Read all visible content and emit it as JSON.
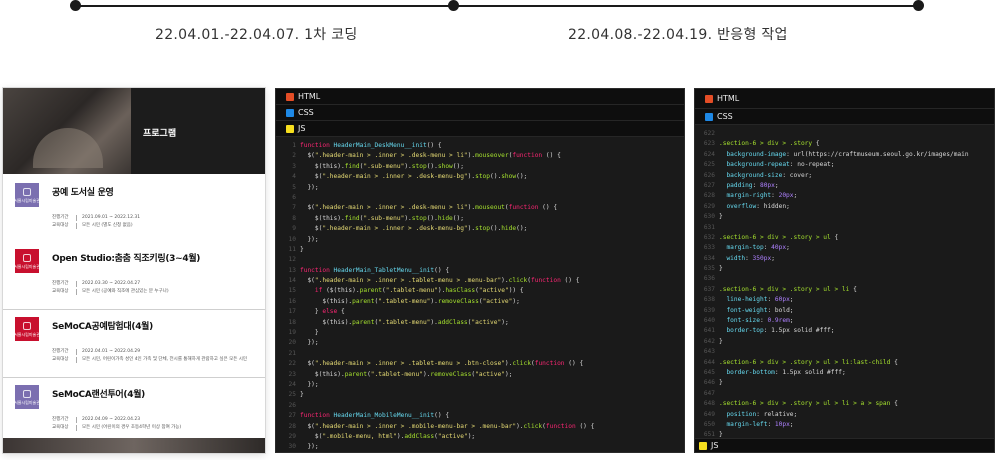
{
  "timeline": {
    "labels": [
      "22.04.01.-22.04.07. 1차 코딩",
      "22.04.08.-22.04.19. 반응형 작업"
    ]
  },
  "phone": {
    "hero_title": "프로그램",
    "logo_text": "서울시립미술관",
    "programs": [
      {
        "title": "공예 도서실 운영",
        "period_label": "진행기간",
        "period": "2021.09.01 ~ 2022.12.31",
        "target_label": "교육대상",
        "target": "모든 시민 (별도 신청 없음)",
        "logo_color": "#7b6fb0"
      },
      {
        "title": "Open Studio:춤춤 직조키링(3~4월)",
        "period_label": "진행기간",
        "period": "2022.03.30 ~ 2022.04.27",
        "target_label": "교육대상",
        "target": "모든 시민 (공예와 직조에 관심있는 분 누구나)",
        "logo_color": "#c8102e"
      },
      {
        "title": "SeMoCA공예탐험대(4월)",
        "period_label": "진행기간",
        "period": "2022.04.01 ~ 2022.04.29",
        "target_label": "교육대상",
        "target": "모든 시민, 어린이가족 성인 4인 가족 및 단체, 전시를 통해하게 관람하고 싶은 모든 시민",
        "logo_color": "#c8102e"
      },
      {
        "title": "SeMoCA랜선투어(4월)",
        "period_label": "진행기간",
        "period": "2022.04.09 ~ 2022.04.23",
        "target_label": "교육대상",
        "target": "모든 시민 (어린이의 경우 초등4학년 이상 참여 가능)",
        "logo_color": "#7b6fb0"
      }
    ]
  },
  "js_panel": {
    "tabs": [
      "HTML",
      "CSS",
      "JS"
    ],
    "lines": [
      [
        "1",
        "function HeaderMain_DeskMenu__init() {"
      ],
      [
        "2",
        "  $(\".header-main > .inner > .desk-menu > li\").mouseover(function () {"
      ],
      [
        "3",
        "    $(this).find(\".sub-menu\").stop().show();"
      ],
      [
        "4",
        "    $(\".header-main > .inner > .desk-menu-bg\").stop().show();"
      ],
      [
        "5",
        "  });"
      ],
      [
        "6",
        ""
      ],
      [
        "7",
        "  $(\".header-main > .inner > .desk-menu > li\").mouseout(function () {"
      ],
      [
        "8",
        "    $(this).find(\".sub-menu\").stop().hide();"
      ],
      [
        "9",
        "    $(\".header-main > .inner > .desk-menu-bg\").stop().hide();"
      ],
      [
        "10",
        "  });"
      ],
      [
        "11",
        "}"
      ],
      [
        "12",
        ""
      ],
      [
        "13",
        "function HeaderMain_TabletMenu__init() {"
      ],
      [
        "14",
        "  $(\".header-main > .inner > .tablet-menu > .menu-bar\").click(function () {"
      ],
      [
        "15",
        "    if ($(this).parent(\".tablet-menu\").hasClass(\"active\")) {"
      ],
      [
        "16",
        "      $(this).parent(\".tablet-menu\").removeClass(\"active\");"
      ],
      [
        "17",
        "    } else {"
      ],
      [
        "18",
        "      $(this).parent(\".tablet-menu\").addClass(\"active\");"
      ],
      [
        "19",
        "    }"
      ],
      [
        "20",
        "  });"
      ],
      [
        "21",
        ""
      ],
      [
        "22",
        "  $(\".header-main > .inner > .tablet-menu > .btn-close\").click(function () {"
      ],
      [
        "23",
        "    $(this).parent(\".tablet-menu\").removeClass(\"active\");"
      ],
      [
        "24",
        "  });"
      ],
      [
        "25",
        "}"
      ],
      [
        "26",
        ""
      ],
      [
        "27",
        "function HeaderMain_MobileMenu__init() {"
      ],
      [
        "28",
        "  $(\".header-main > .inner > .mobile-menu-bar > .menu-bar\").click(function () {"
      ],
      [
        "29",
        "    $(\".mobile-menu, html\").addClass(\"active\");"
      ],
      [
        "30",
        "  });"
      ]
    ]
  },
  "css_panel": {
    "tabs": [
      "HTML",
      "CSS",
      "JS"
    ],
    "lines": [
      [
        "622",
        ""
      ],
      [
        "623",
        ".section-6 > div > .story {"
      ],
      [
        "624",
        "  background-image: url(https://craftmuseum.seoul.go.kr/images/main"
      ],
      [
        "625",
        "  background-repeat: no-repeat;"
      ],
      [
        "626",
        "  background-size: cover;"
      ],
      [
        "627",
        "  padding: 80px;"
      ],
      [
        "628",
        "  margin-right: 20px;"
      ],
      [
        "629",
        "  overflow: hidden;"
      ],
      [
        "630",
        "}"
      ],
      [
        "631",
        ""
      ],
      [
        "632",
        ".section-6 > div > .story > ul {"
      ],
      [
        "633",
        "  margin-top: 40px;"
      ],
      [
        "634",
        "  width: 350px;"
      ],
      [
        "635",
        "}"
      ],
      [
        "636",
        ""
      ],
      [
        "637",
        ".section-6 > div > .story > ul > li {"
      ],
      [
        "638",
        "  line-height: 60px;"
      ],
      [
        "639",
        "  font-weight: bold;"
      ],
      [
        "640",
        "  font-size: 0.9rem;"
      ],
      [
        "641",
        "  border-top: 1.5px solid #fff;"
      ],
      [
        "642",
        "}"
      ],
      [
        "643",
        ""
      ],
      [
        "644",
        ".section-6 > div > .story > ul > li:last-child {"
      ],
      [
        "645",
        "  border-bottom: 1.5px solid #fff;"
      ],
      [
        "646",
        "}"
      ],
      [
        "647",
        ""
      ],
      [
        "648",
        ".section-6 > div > .story > ul > li > a > span {"
      ],
      [
        "649",
        "  position: relative;"
      ],
      [
        "650",
        "  margin-left: 10px;"
      ],
      [
        "651",
        "}"
      ]
    ]
  }
}
